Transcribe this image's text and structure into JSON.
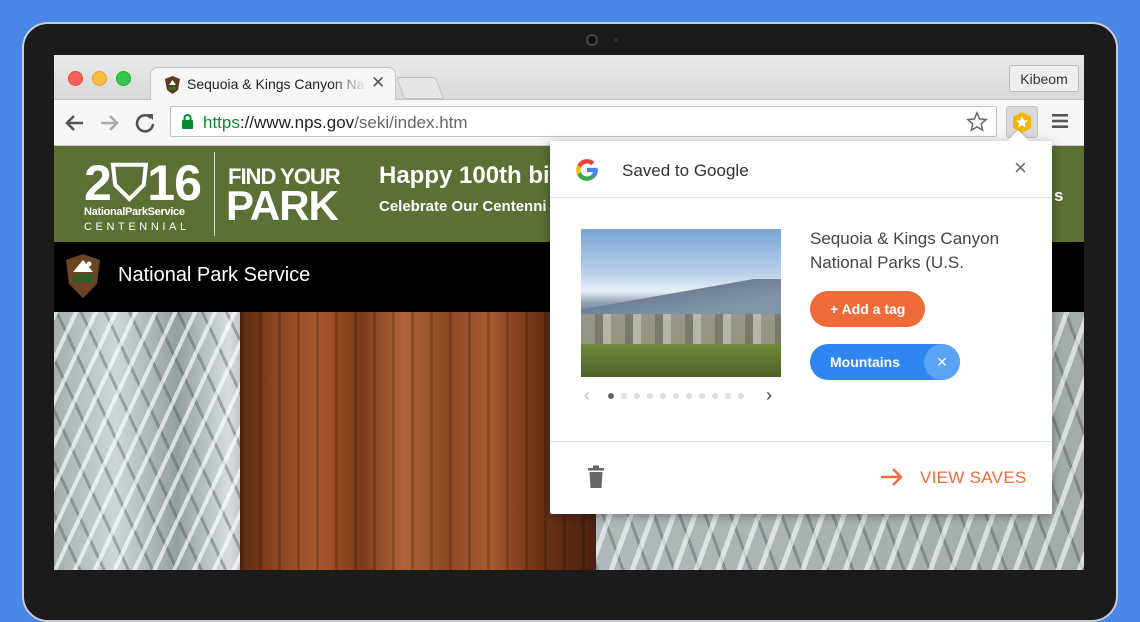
{
  "browser": {
    "tab_title": "Sequoia & Kings Canyon National Parks (U.S.",
    "tab_close": "✕",
    "profile_name": "Kibeom",
    "url_scheme": "https",
    "url_host": "://www.nps.gov",
    "url_path": "/seki/index.htm"
  },
  "page": {
    "banner_year": "2⛉16",
    "banner_nps": "NationalParkService",
    "banner_centennial": "CENTENNIAL",
    "banner_find": "FIND YOUR",
    "banner_park": "PARK",
    "banner_headline": "Happy 100th bi",
    "banner_subline": "Celebrate Our Centenni",
    "banner_right_fragment": "s",
    "nps_title": "National Park Service"
  },
  "popup": {
    "title": "Saved to Google",
    "close": "×",
    "item_title": "Sequoia & Kings Canyon National Parks (U.S.",
    "add_tag_label": "+ Add a tag",
    "tag_label": "Mountains",
    "tag_remove": "×",
    "carousel_prev": "‹",
    "carousel_next": "›",
    "carousel_total": 11,
    "carousel_active_index": 0,
    "view_saves_label": "VIEW SAVES"
  },
  "colors": {
    "accent_orange": "#ef6b3a",
    "chip_blue": "#2e86f0",
    "banner_green": "#5c6f35",
    "url_green": "#0a8a2e"
  },
  "icons": [
    "back-arrow-icon",
    "forward-arrow-icon",
    "reload-icon",
    "lock-icon",
    "star-outline-icon",
    "save-to-google-star-icon",
    "hamburger-menu-icon",
    "google-g-icon",
    "trash-icon",
    "arrow-right-icon",
    "nps-arrowhead-icon"
  ]
}
